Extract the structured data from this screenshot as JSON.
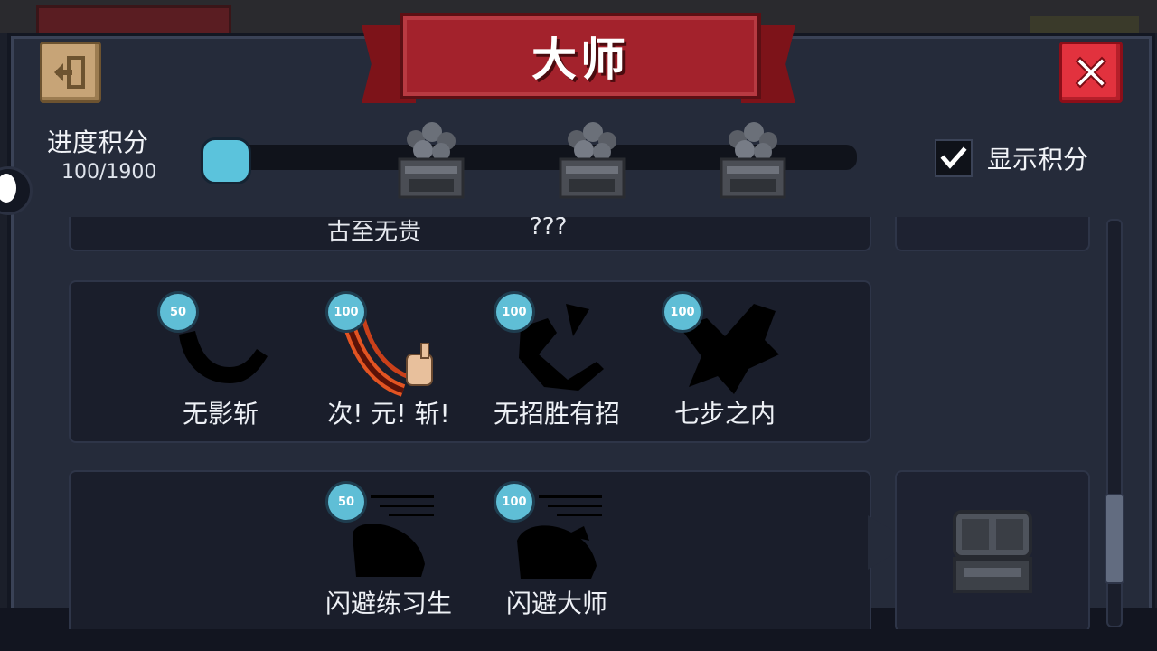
{
  "title": "大师",
  "progress": {
    "label": "进度积分",
    "value_text": "100/1900",
    "current": 100,
    "max": 1900
  },
  "show_score": {
    "label": "显示积分",
    "checked": true
  },
  "top_card": {
    "items": [
      "古至无贵",
      "???"
    ]
  },
  "row_one": [
    {
      "points": "50",
      "label": "无影斩",
      "unlocked": false
    },
    {
      "points": "100",
      "label": "次! 元! 斩!",
      "unlocked": true
    },
    {
      "points": "100",
      "label": "无招胜有招",
      "unlocked": false
    },
    {
      "points": "100",
      "label": "七步之内",
      "unlocked": false
    }
  ],
  "row_two": [
    {
      "points": "50",
      "label": "闪避练习生",
      "unlocked": false
    },
    {
      "points": "100",
      "label": "闪避大师",
      "unlocked": false
    }
  ],
  "colors": {
    "accent": "#5bc3dc",
    "banner": "#a3222c",
    "close": "#e2323e",
    "exit": "#c7a477"
  },
  "icons": {
    "exit": "exit-door-icon",
    "close": "close-x-icon",
    "check": "checkmark-icon",
    "chest": "treasure-chest-icon"
  }
}
